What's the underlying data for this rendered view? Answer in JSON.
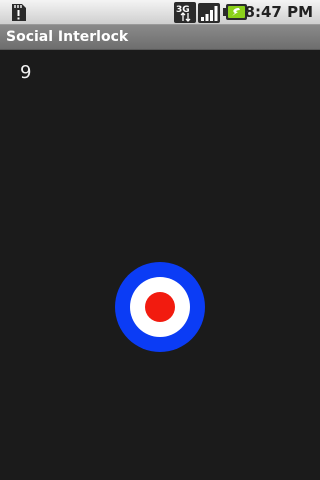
{
  "status_bar": {
    "time": "8:47 PM",
    "network": "3G",
    "icons": [
      "sd-card-alert-icon",
      "3g-data-icon",
      "signal-strength-icon",
      "battery-charging-icon"
    ]
  },
  "app": {
    "title": "Social Interlock"
  },
  "main": {
    "counter": "9",
    "target": {
      "outer_color": "#0b3cf5",
      "middle_color": "#ffffff",
      "inner_color": "#f21b0f"
    }
  },
  "colors": {
    "background": "#1b1b1b",
    "title_bar": "#7b7b7b",
    "status_bar": "#dedede"
  }
}
